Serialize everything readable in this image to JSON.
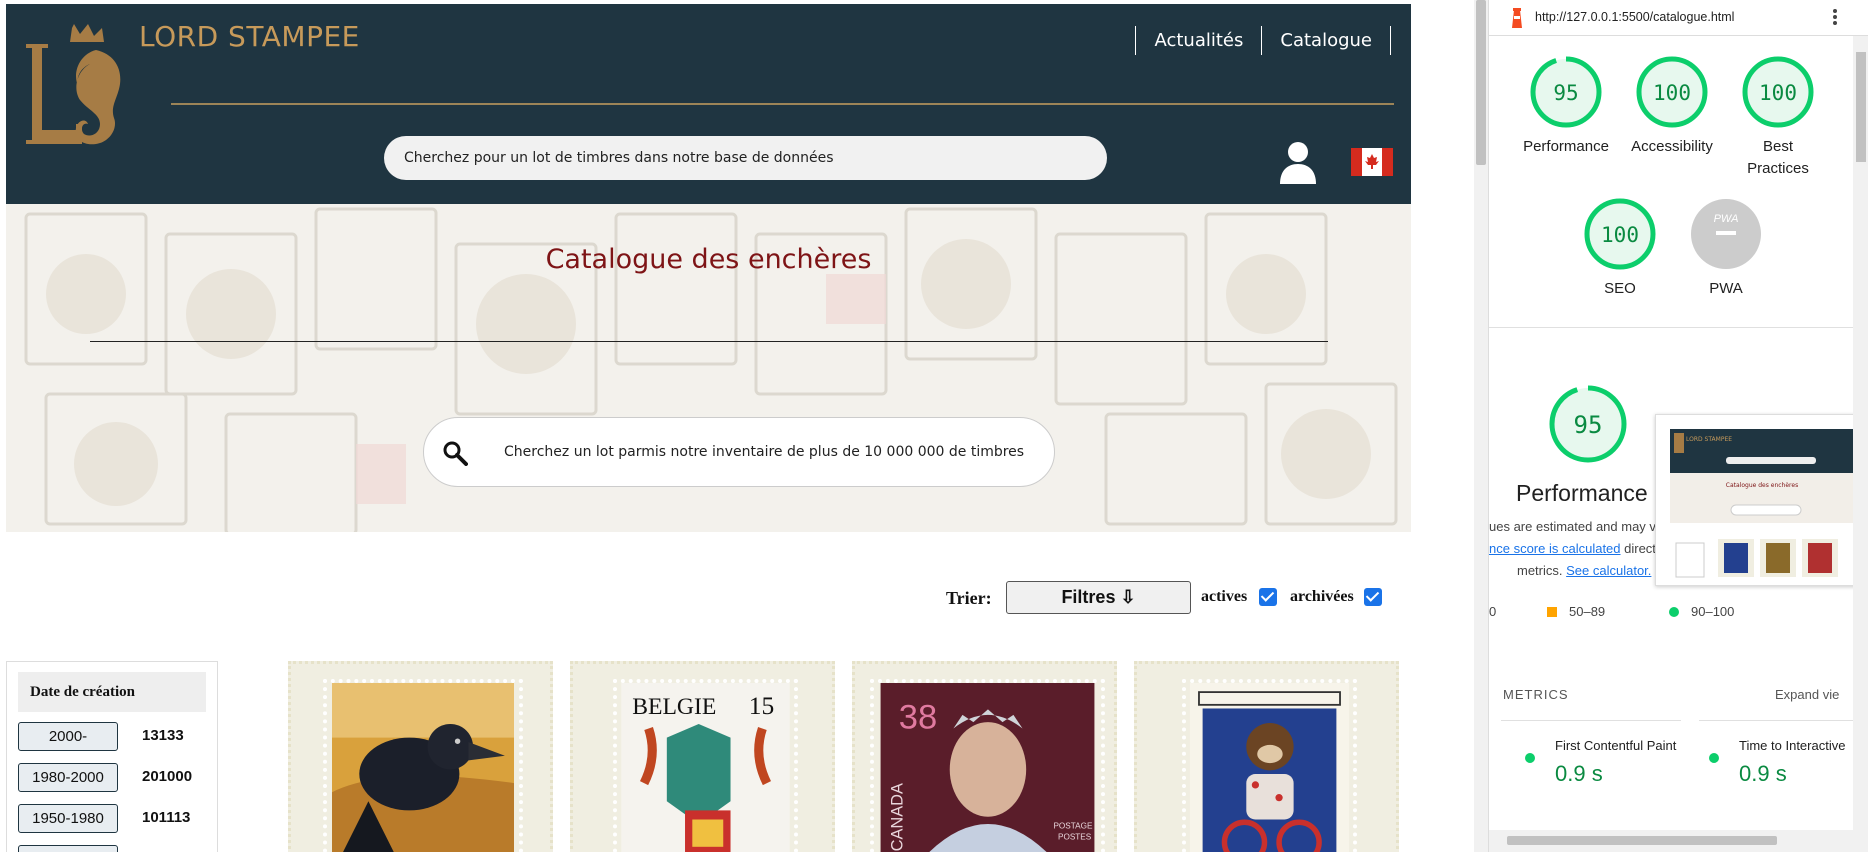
{
  "site": {
    "brand": "LORD STAMPEE",
    "nav": [
      "Actualités",
      "Catalogue"
    ],
    "header_search_placeholder": "Cherchez pour un lot de timbres dans notre base de données",
    "hero_title": "Catalogue des enchères",
    "hero_search_placeholder": "Cherchez un lot parmis notre inventaire de plus de 10 000 000 de timbres",
    "sort_label": "Trier:",
    "filter_button": "Filtres ⇩",
    "checkbox_actives": "actives",
    "checkbox_archivees": "archivées",
    "filters_title": "Date de création",
    "filters": [
      {
        "label": "2000-",
        "count": "13133"
      },
      {
        "label": "1980-2000",
        "count": "201000"
      },
      {
        "label": "1950-1980",
        "count": "101113"
      }
    ],
    "stamps": [
      {
        "name": "raven-stamp"
      },
      {
        "name": "belgium-stamp",
        "country": "BELGIE",
        "value": "15"
      },
      {
        "name": "queen-stamp",
        "value": "38",
        "country": "CANADA",
        "tag1": "POSTAGE",
        "tag2": "POSTES"
      },
      {
        "name": "monkey-stamp"
      }
    ],
    "colors": {
      "header": "#1f3541",
      "gold": "#c79a5a",
      "title": "#7e1416"
    }
  },
  "lighthouse": {
    "url": "http://127.0.0.1:5500/catalogue.html",
    "gauges": [
      {
        "label": "Performance",
        "score": "95"
      },
      {
        "label": "Accessibility",
        "score": "100"
      },
      {
        "label": "Best\nPractices",
        "score": "100"
      },
      {
        "label": "SEO",
        "score": "100"
      },
      {
        "label": "PWA",
        "score": ""
      }
    ],
    "pwa_badge": "PWA",
    "big_score": "95",
    "big_label": "Performance",
    "note_line1": "ues are estimated and may va",
    "note_line2_link": "nce score is calculated",
    "note_line2_rest": " direct",
    "note_line3_text": "metrics. ",
    "note_line3_link": "See calculator.",
    "legend_mid": "50–89",
    "legend_high": "90–100",
    "legend_cut": "0",
    "metrics_title": "METRICS",
    "expand": "Expand vie",
    "metrics": [
      {
        "name": "First Contentful Paint",
        "value": "0.9 s"
      },
      {
        "name": "Time to Interactive",
        "value": "0.9 s"
      }
    ],
    "shot_brand": "LORD STAMPEE",
    "shot_title": "Catalogue des enchères",
    "colors": {
      "pass": "#0cce6b",
      "pass_fill": "#e7f8ee",
      "avg": "#ffa400",
      "pwa": "#cccccc"
    }
  }
}
